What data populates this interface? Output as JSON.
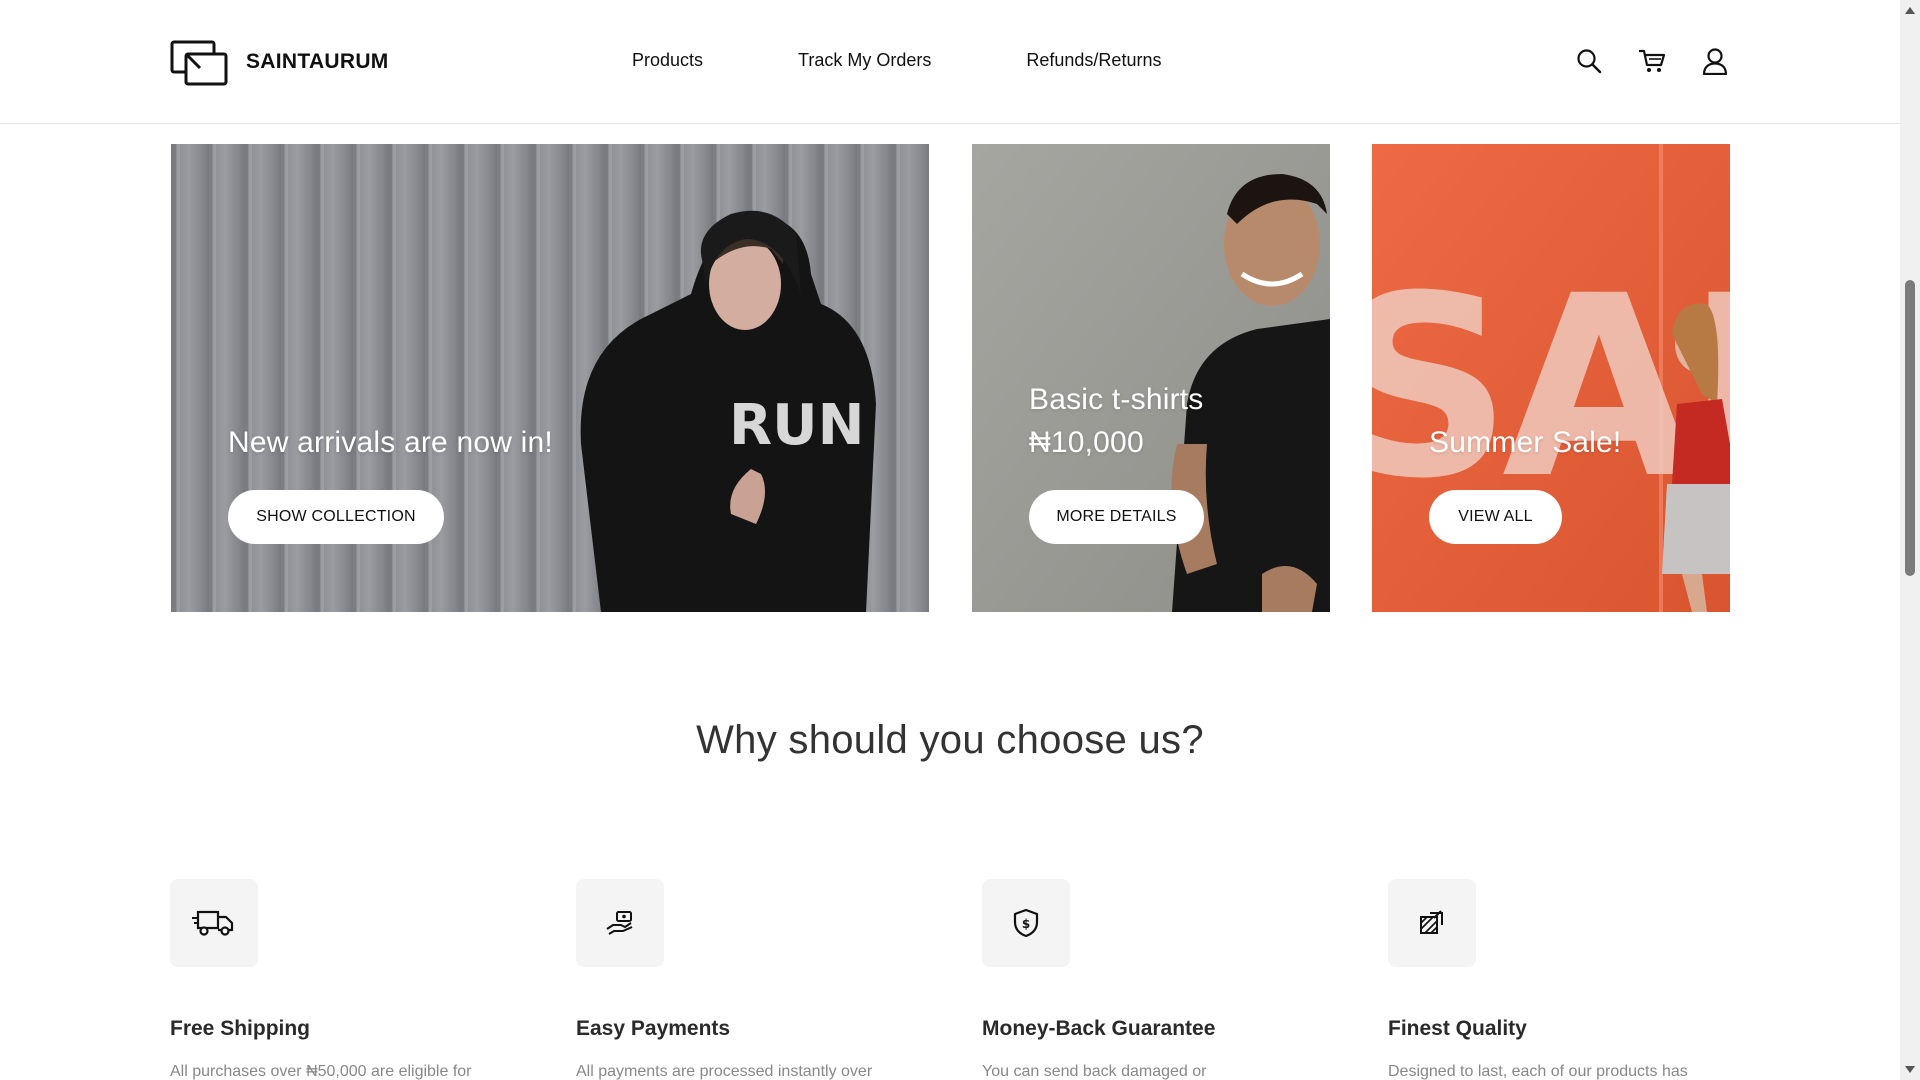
{
  "header": {
    "brand": "SAINTAURUM",
    "nav": [
      {
        "label": "Products"
      },
      {
        "label": "Track My Orders"
      },
      {
        "label": "Refunds/Returns"
      }
    ],
    "icons": [
      "search-icon",
      "cart-icon",
      "user-icon"
    ]
  },
  "banners": [
    {
      "heading": "New arrivals are now in!",
      "button": "SHOW COLLECTION",
      "art_text": "RUN",
      "color": "#8d8f94"
    },
    {
      "heading": "Basic t-shirts",
      "price": "₦10,000",
      "button": "MORE DETAILS",
      "color": "#9c9c97"
    },
    {
      "heading": "Summer Sale!",
      "button": "VIEW ALL",
      "art_text": "SALE",
      "color": "#e9613a"
    }
  ],
  "why": {
    "title": "Why should you choose us?",
    "features": [
      {
        "icon": "truck-icon",
        "title": "Free Shipping",
        "text": "All purchases over ₦50,000 are eligible for"
      },
      {
        "icon": "hand-money-icon",
        "title": "Easy Payments",
        "text": "All payments are processed instantly over"
      },
      {
        "icon": "shield-dollar-icon",
        "title": "Money-Back Guarantee",
        "text": "You can send back damaged or"
      },
      {
        "icon": "quality-icon",
        "title": "Finest Quality",
        "text": "Designed to last, each of our products has"
      }
    ]
  }
}
